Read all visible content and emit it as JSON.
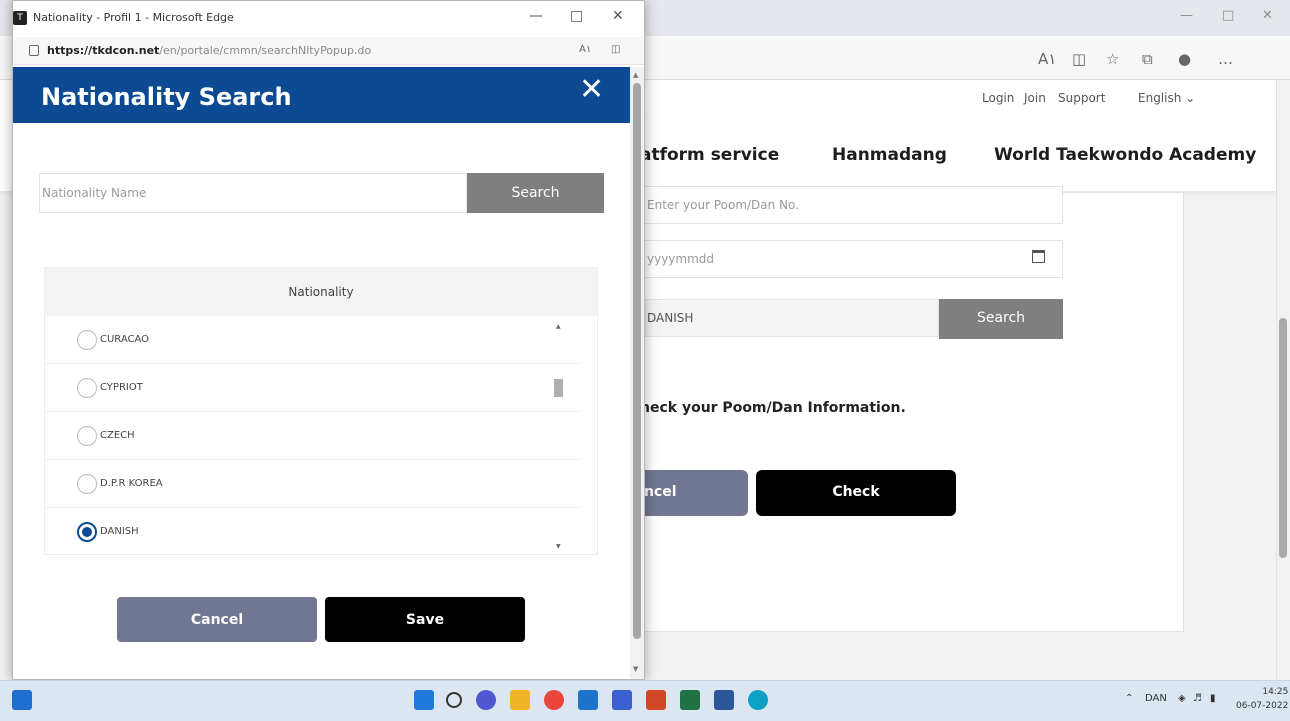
{
  "popup": {
    "window_title": "Nationality - Profil 1 - Microsoft Edge",
    "url_host": "https://tkdcon.net",
    "url_path": "/en/portale/cmmn/searchNltyPopup.do",
    "header_title": "Nationality Search",
    "search": {
      "placeholder": "Nationality Name",
      "value": "",
      "button_label": "Search"
    },
    "list": {
      "column_header": "Nationality",
      "items": [
        {
          "label": "CURACAO",
          "selected": false
        },
        {
          "label": "CYPRIOT",
          "selected": false
        },
        {
          "label": "CZECH",
          "selected": false
        },
        {
          "label": "D.P.R KOREA",
          "selected": false
        },
        {
          "label": "DANISH",
          "selected": true
        }
      ]
    },
    "cancel_label": "Cancel",
    "save_label": "Save"
  },
  "background": {
    "topnav": {
      "login": "Login",
      "join": "Join",
      "support": "Support",
      "language": "English"
    },
    "mainnav": {
      "item1": "atform service",
      "item2": "Hanmadang",
      "item3": "World Taekwondo Academy"
    },
    "form": {
      "poom_dan_placeholder": "Enter your Poom/Dan No.",
      "date_placeholder": "yyyymmdd",
      "nationality_value": "DANISH",
      "search_label": "Search",
      "info_text": "heck your Poom/Dan Information.",
      "cancel_label": "ncel",
      "check_label": "Check"
    }
  },
  "taskbar": {
    "language": "DAN",
    "time": "14:25",
    "date": "06-07-2022"
  },
  "colors": {
    "header_blue": "#0d4a94",
    "cancel_slate": "#717792",
    "search_gray": "#7f7f7f",
    "save_black": "#000000"
  }
}
